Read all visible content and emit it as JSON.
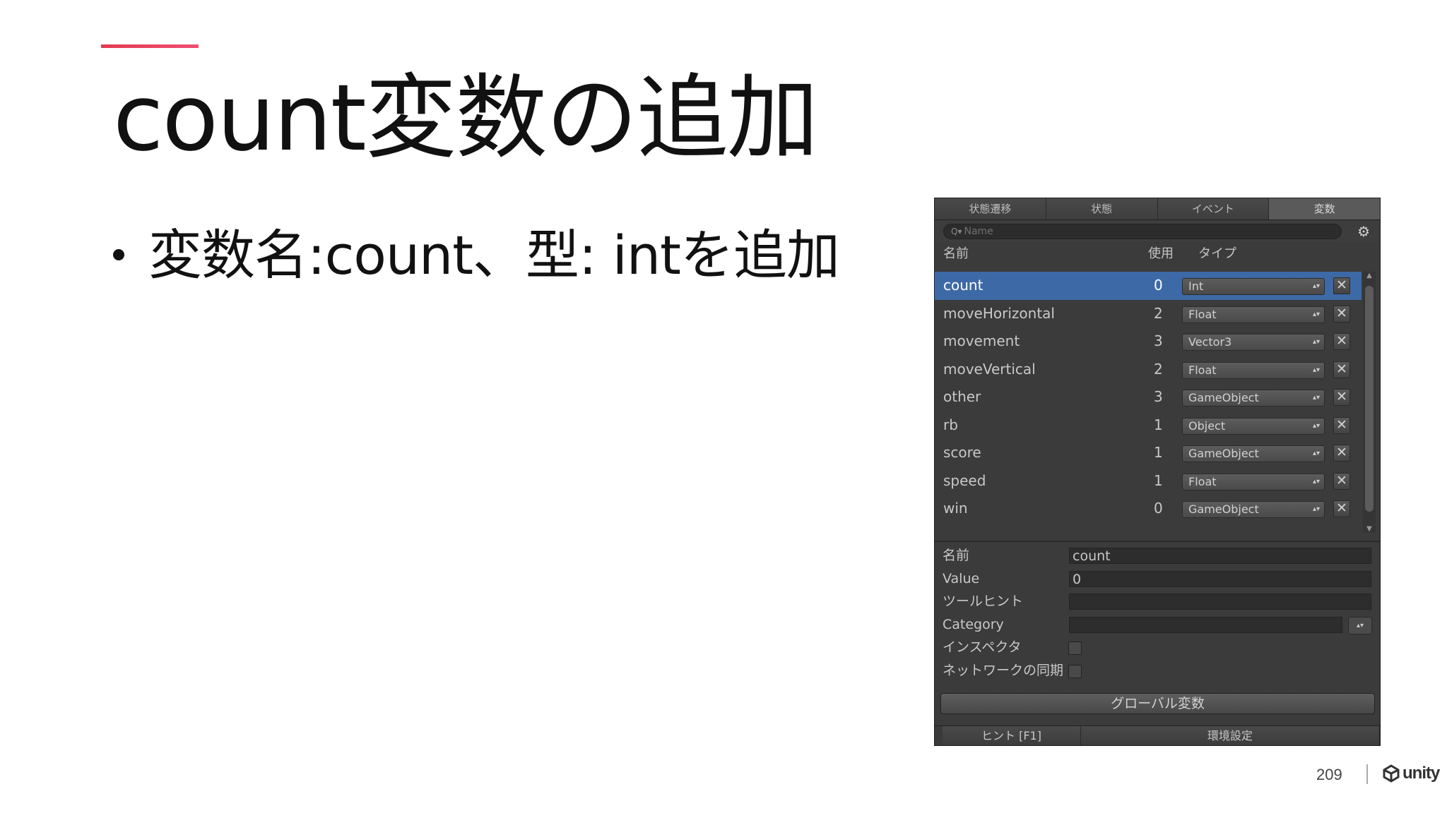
{
  "slide": {
    "title": "count変数の追加",
    "bullet": "変数名:count、型: intを追加",
    "page_number": "209",
    "logo_text": "unity",
    "accent_color": "#e8415f"
  },
  "panel": {
    "tabs": [
      {
        "label": "状態遷移",
        "active": false
      },
      {
        "label": "状態",
        "active": false
      },
      {
        "label": "イベント",
        "active": false
      },
      {
        "label": "変数",
        "active": true
      }
    ],
    "search_placeholder": "Name",
    "columns": {
      "name": "名前",
      "used": "使用",
      "type": "タイプ"
    },
    "variables": [
      {
        "name": "count",
        "used": "0",
        "type": "Int",
        "selected": true
      },
      {
        "name": "moveHorizontal",
        "used": "2",
        "type": "Float",
        "selected": false
      },
      {
        "name": "movement",
        "used": "3",
        "type": "Vector3",
        "selected": false
      },
      {
        "name": "moveVertical",
        "used": "2",
        "type": "Float",
        "selected": false
      },
      {
        "name": "other",
        "used": "3",
        "type": "GameObject",
        "selected": false
      },
      {
        "name": "rb",
        "used": "1",
        "type": "Object",
        "selected": false
      },
      {
        "name": "score",
        "used": "1",
        "type": "GameObject",
        "selected": false
      },
      {
        "name": "speed",
        "used": "1",
        "type": "Float",
        "selected": false
      },
      {
        "name": "win",
        "used": "0",
        "type": "GameObject",
        "selected": false
      }
    ],
    "properties": {
      "name_label": "名前",
      "name_value": "count",
      "value_label": "Value",
      "value_value": "0",
      "tooltip_label": "ツールヒント",
      "tooltip_value": "",
      "category_label": "Category",
      "category_value": "",
      "inspector_label": "インスペクタ",
      "network_label": "ネットワークの同期"
    },
    "global_button": "グローバル変数",
    "footer": {
      "hint": "ヒント [F1]",
      "settings": "環境設定"
    },
    "selection_color": "#3d6aa6"
  }
}
